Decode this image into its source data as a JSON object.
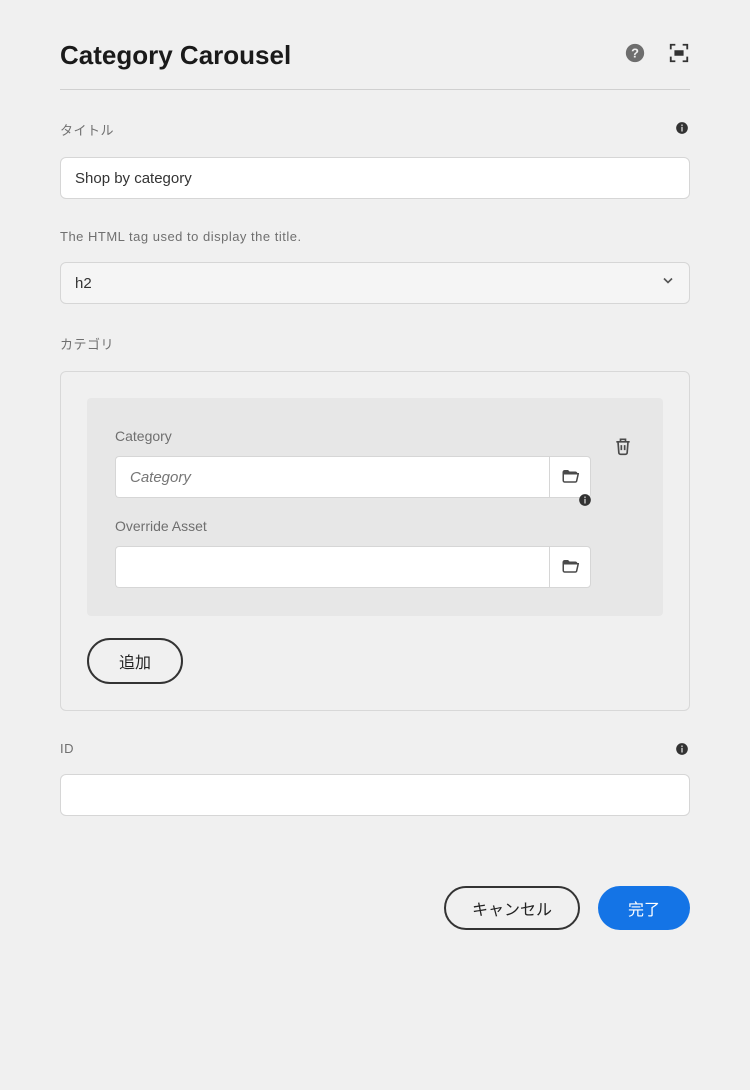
{
  "header": {
    "title": "Category Carousel"
  },
  "fields": {
    "title": {
      "label": "タイトル",
      "value": "Shop by category"
    },
    "tag": {
      "label": "The HTML tag used to display the title.",
      "value": "h2"
    },
    "category": {
      "label": "カテゴリ",
      "item": {
        "category_label": "Category",
        "category_placeholder": "Category",
        "category_value": "",
        "override_label": "Override Asset",
        "override_value": ""
      },
      "add_label": "追加"
    },
    "id": {
      "label": "ID",
      "value": ""
    }
  },
  "footer": {
    "cancel_label": "キャンセル",
    "done_label": "完了"
  }
}
